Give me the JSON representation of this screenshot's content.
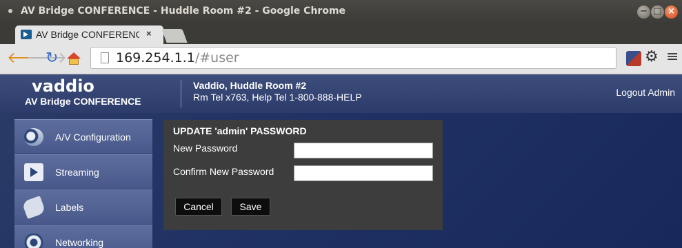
{
  "window": {
    "title": "AV Bridge CONFERENCE - Huddle Room #2 - Google Chrome",
    "controls": [
      "minimize",
      "maximize",
      "close"
    ]
  },
  "tabs": [
    {
      "title": "AV Bridge CONFERENC",
      "close": "×",
      "active": true
    }
  ],
  "toolbar": {
    "url_host": "169.254.1.1",
    "url_path": "/#user",
    "icons": [
      "back-arrow-icon",
      "forward-arrow-icon",
      "reload-icon",
      "home-icon",
      "extension-icon",
      "gear-icon",
      "menu-icon"
    ]
  },
  "header": {
    "logo": "vaddio",
    "product": "AV Bridge CONFERENCE",
    "room_name": "Vaddio, Huddle Room #2",
    "room_contact": "Rm Tel x763, Help Tel 1-800-888-HELP",
    "logout": "Logout Admin"
  },
  "sidebar": {
    "items": [
      {
        "label": "A/V Configuration",
        "icon": "av-configuration-icon"
      },
      {
        "label": "Streaming",
        "icon": "streaming-icon"
      },
      {
        "label": "Labels",
        "icon": "labels-icon"
      },
      {
        "label": "Networking",
        "icon": "networking-icon"
      }
    ]
  },
  "password_form": {
    "title": "UPDATE 'admin' PASSWORD",
    "new_password_label": "New Password",
    "confirm_password_label": "Confirm New Password",
    "new_password_value": "",
    "confirm_password_value": "",
    "cancel_label": "Cancel",
    "save_label": "Save"
  },
  "colors": {
    "header_bg": "#3e4e7c",
    "page_bg": "#1f3063",
    "sidebar_bg": "#5d6e9e",
    "panel_bg": "#3d3d3d",
    "button_bg": "#0d0d0d"
  }
}
